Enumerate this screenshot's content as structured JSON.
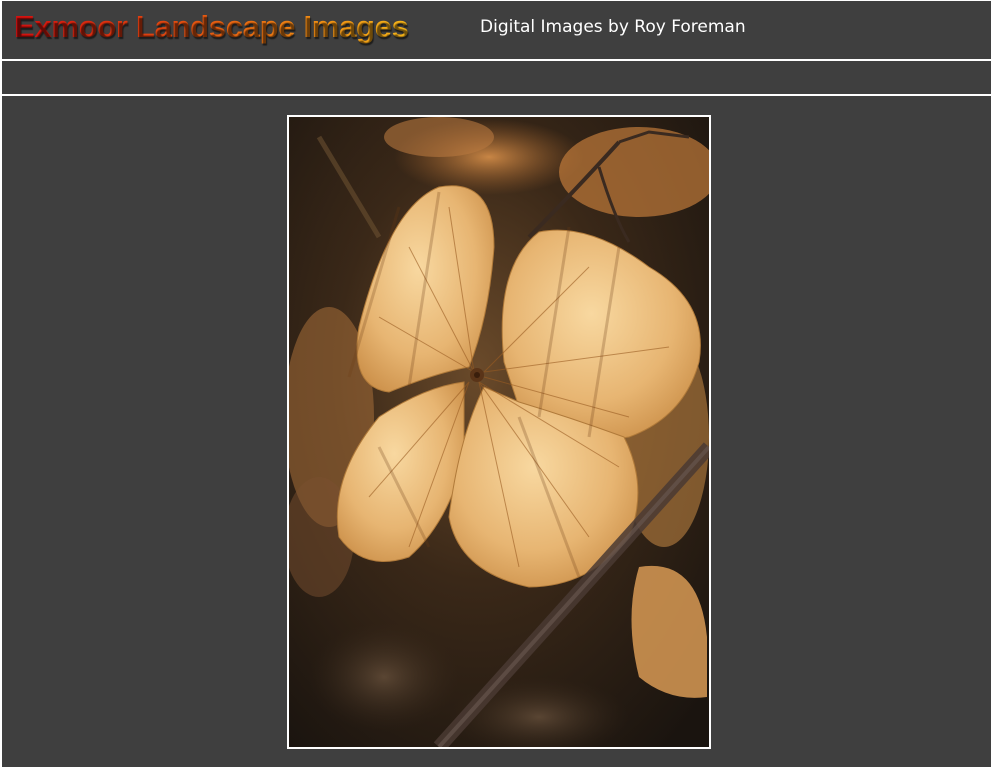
{
  "header": {
    "site_title": "Exmoor Landscape Images",
    "subtitle": "Digital Images by Roy Foreman"
  },
  "colors": {
    "background": "#3f3f3f",
    "border": "#ffffff",
    "title_gradient": [
      "#d40f0f",
      "#ef8a14",
      "#f6b61a"
    ],
    "subtitle_text": "#ffffff"
  },
  "photo": {
    "subject": "backlit-dried-hydrangea-flower-icon"
  }
}
